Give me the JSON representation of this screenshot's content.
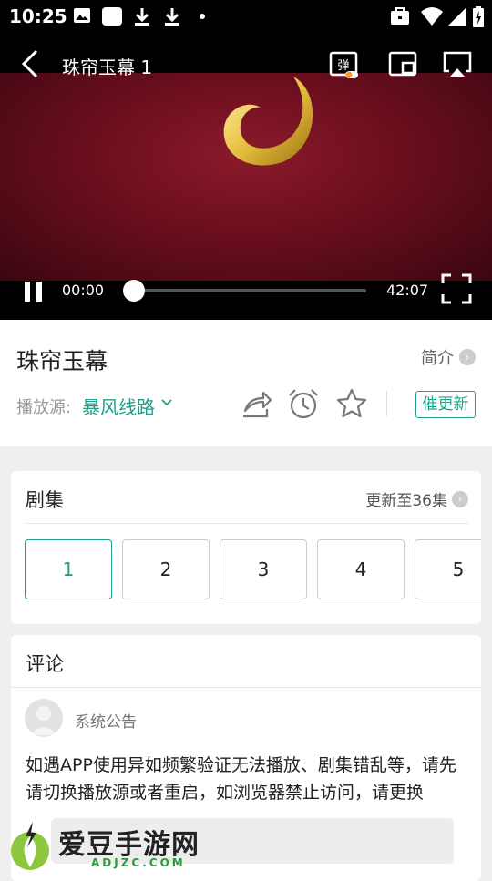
{
  "status_bar": {
    "time": "10:25"
  },
  "player": {
    "title": "珠帘玉幕 1",
    "current_time": "00:00",
    "total_time": "42:07",
    "progress": 0
  },
  "info": {
    "title": "珠帘玉幕",
    "intro_label": "简介",
    "source_label": "播放源:",
    "source_value": "暴风线路",
    "urge_label": "催更新"
  },
  "episodes": {
    "title": "剧集",
    "update_status": "更新至36集",
    "items": [
      "1",
      "2",
      "3",
      "4",
      "5"
    ],
    "selected": "1"
  },
  "comments": {
    "title": "评论",
    "first": {
      "author": "系统公告",
      "text": "如遇APP使用异如频繁验证无法播放、剧集错乱等，请先请切换播放源或者重启，如浏览器禁止访问，请更换"
    }
  },
  "watermark": {
    "name": "爱豆手游网",
    "domain": "ADJZC.COM"
  },
  "colors": {
    "accent": "#1e9e86",
    "video_bg": "#6b0e1e"
  }
}
